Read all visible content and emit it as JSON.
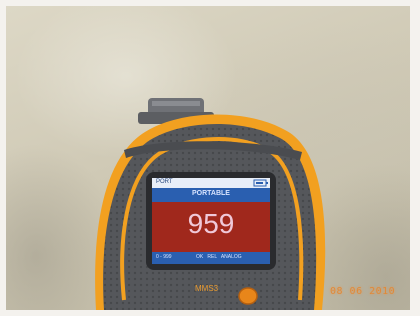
{
  "screen": {
    "status_left": "PORT",
    "header": "PORTABLE",
    "reading": "959",
    "footer_left": "0 ‑ 999",
    "footer_right": "OK   REL   ANALOG"
  },
  "device": {
    "model": "MMS3"
  },
  "date_stamp": "08 06 2010",
  "colors": {
    "housing_orange": "#f2a020",
    "housing_gray": "#5a5c60",
    "screen_red": "#a0281c",
    "screen_blue": "#2a5fb0",
    "wall": "#d6d0bc"
  },
  "icons": [
    "battery-icon",
    "power-button-icon"
  ]
}
